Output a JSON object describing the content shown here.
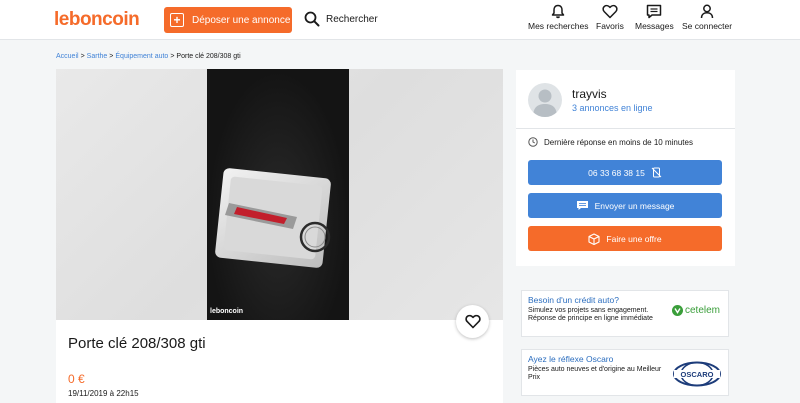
{
  "header": {
    "logo": "leboncoin",
    "deposit_label": "Déposer une annonce",
    "search_label": "Rechercher",
    "nav": [
      {
        "label": "Mes recherches",
        "icon": "bell-icon"
      },
      {
        "label": "Favoris",
        "icon": "heart-icon"
      },
      {
        "label": "Messages",
        "icon": "message-icon"
      },
      {
        "label": "Se connecter",
        "icon": "user-icon"
      }
    ]
  },
  "breadcrumb": {
    "items": [
      "Accueil",
      "Sarthe",
      "Équipement auto"
    ],
    "separator": ">",
    "current": "Porte clé 208/308 gti"
  },
  "gallery": {
    "watermark": "leboncoin"
  },
  "ad": {
    "title": "Porte clé 208/308 gti",
    "price": "0 €",
    "date": "19/11/2019 à 22h15"
  },
  "seller": {
    "name": "trayvis",
    "ads_count": "3 annonces en ligne",
    "response_time": "Dernière réponse en moins de 10 minutes",
    "phone": "06 33 68 38 15",
    "message_label": "Envoyer un message",
    "offer_label": "Faire une offre"
  },
  "promos": [
    {
      "title": "Besoin d'un crédit auto?",
      "text": "Simulez vos projets sans engagement. Réponse de principe en ligne immédiate",
      "logo_text": "cetelem"
    },
    {
      "title": "Ayez le réflexe Oscaro",
      "text": "Pièces auto neuves et d'origine au Meilleur Prix",
      "logo_text": "OSCARO"
    }
  ],
  "colors": {
    "brand_orange": "#f56b2a",
    "link_blue": "#4183d7",
    "background": "#f4f6f7"
  }
}
